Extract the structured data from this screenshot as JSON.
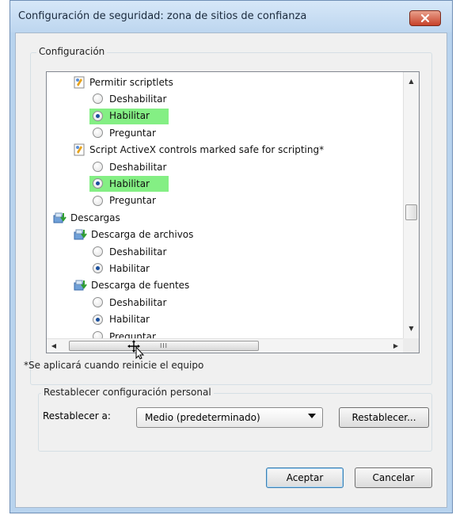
{
  "window": {
    "title": "Configuración de seguridad: zona de sitios de confianza"
  },
  "settings_group": {
    "legend": "Configuración",
    "items": [
      {
        "type": "setting",
        "label": "Permitir scriptlets"
      },
      {
        "type": "radio",
        "label": "Deshabilitar",
        "checked": false,
        "highlight": false
      },
      {
        "type": "radio",
        "label": "Habilitar",
        "checked": true,
        "highlight": true
      },
      {
        "type": "radio",
        "label": "Preguntar",
        "checked": false,
        "highlight": false
      },
      {
        "type": "setting",
        "label": "Script ActiveX controls marked safe for scripting*"
      },
      {
        "type": "radio",
        "label": "Deshabilitar",
        "checked": false,
        "highlight": false
      },
      {
        "type": "radio",
        "label": "Habilitar",
        "checked": true,
        "highlight": true
      },
      {
        "type": "radio",
        "label": "Preguntar",
        "checked": false,
        "highlight": false
      },
      {
        "type": "category",
        "label": "Descargas"
      },
      {
        "type": "subcategory",
        "label": "Descarga de archivos"
      },
      {
        "type": "radio",
        "label": "Deshabilitar",
        "checked": false,
        "highlight": false
      },
      {
        "type": "radio",
        "label": "Habilitar",
        "checked": true,
        "highlight": false
      },
      {
        "type": "subcategory",
        "label": "Descarga de fuentes"
      },
      {
        "type": "radio",
        "label": "Deshabilitar",
        "checked": false,
        "highlight": false
      },
      {
        "type": "radio",
        "label": "Habilitar",
        "checked": true,
        "highlight": false
      },
      {
        "type": "radio",
        "label": "Preguntar",
        "checked": false,
        "highlight": false
      }
    ],
    "hscroll_grip": "III"
  },
  "footnote": "*Se aplicará cuando reinicie el equipo",
  "reset_group": {
    "legend": "Restablecer configuración personal",
    "label": "Restablecer a:",
    "select_value": "Medio (predeterminado)",
    "button": "Restablecer..."
  },
  "buttons": {
    "ok": "Aceptar",
    "cancel": "Cancelar"
  },
  "colors": {
    "highlight": "#84ef84",
    "titlebar": "#bdd6ef",
    "close": "#c7422a"
  }
}
